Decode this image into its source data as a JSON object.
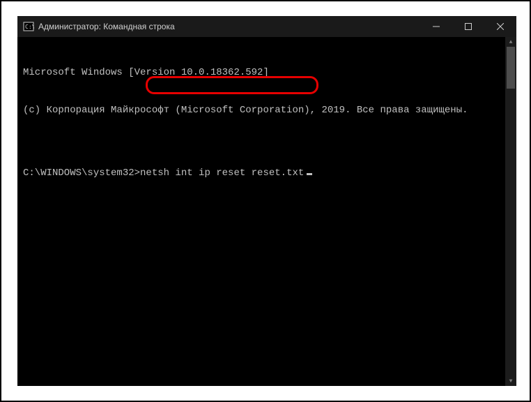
{
  "titlebar": {
    "text": "Администратор: Командная строка"
  },
  "terminal": {
    "line1": "Microsoft Windows [Version 10.0.18362.592]",
    "line2": "(c) Корпорация Майкрософт (Microsoft Corporation), 2019. Все права защищены.",
    "blank": "",
    "prompt": "C:\\WINDOWS\\system32>",
    "command": "netsh int ip reset reset.txt"
  }
}
